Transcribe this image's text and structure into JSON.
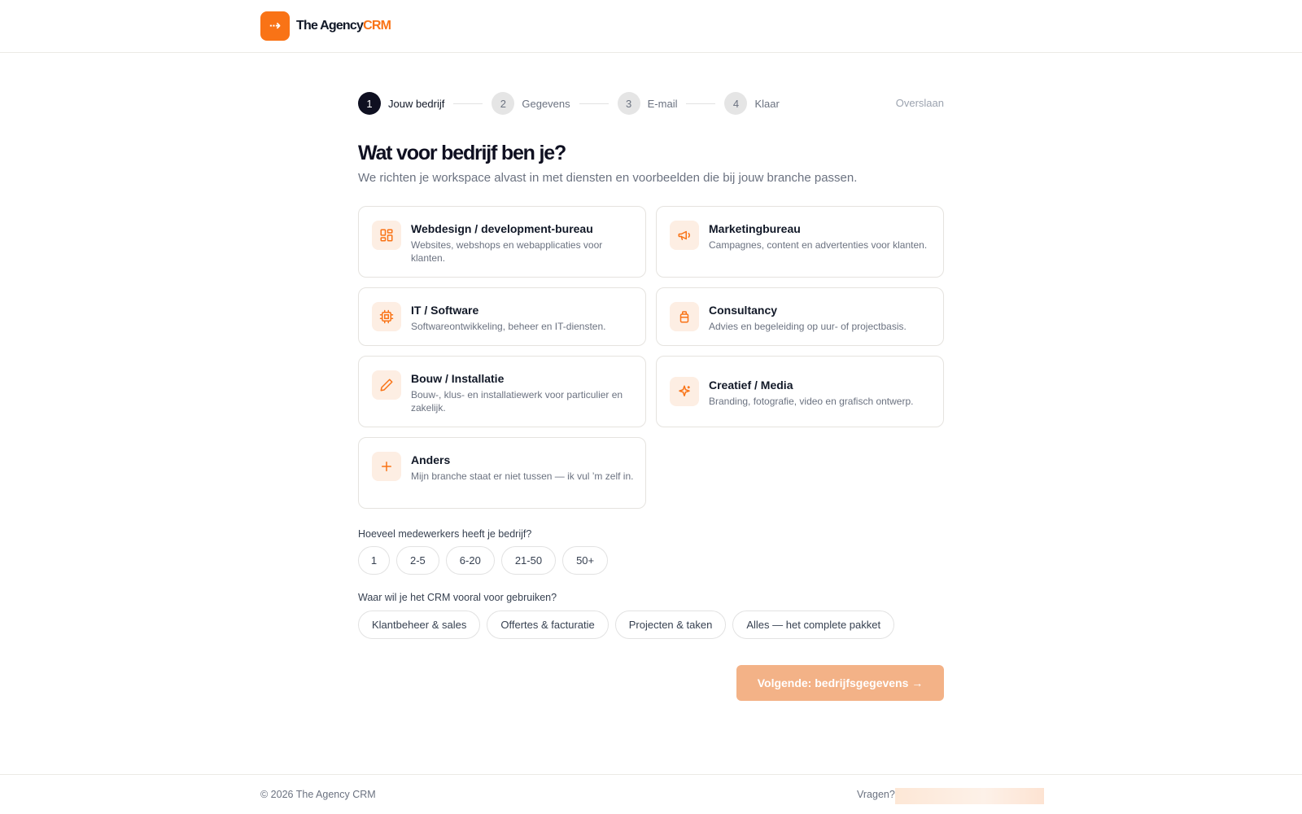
{
  "brand": {
    "name_main": "The Agency",
    "name_accent": "CRM",
    "logo_icon": "arrow-right-left-icon"
  },
  "steps": [
    {
      "number": "1",
      "label": "Jouw bedrijf",
      "active": true
    },
    {
      "number": "2",
      "label": "Gegevens",
      "active": false
    },
    {
      "number": "3",
      "label": "E-mail",
      "active": false
    },
    {
      "number": "4",
      "label": "Klaar",
      "active": false
    }
  ],
  "skip_label": "Overslaan",
  "heading": "Wat voor bedrijf ben je?",
  "subheading": "We richten je workspace alvast in met diensten en voorbeelden die bij jouw branche passen.",
  "business_types": [
    {
      "title": "Webdesign / development-bureau",
      "description": "Websites, webshops en webapplicaties voor klanten.",
      "icon": "layout-grid-icon"
    },
    {
      "title": "Marketingbureau",
      "description": "Campagnes, content en advertenties voor klanten.",
      "icon": "megaphone-icon"
    },
    {
      "title": "IT / Software",
      "description": "Softwareontwikkeling, beheer en IT-diensten.",
      "icon": "cpu-icon"
    },
    {
      "title": "Consultancy",
      "description": "Advies en begeleiding op uur- of projectbasis.",
      "icon": "briefcase-icon"
    },
    {
      "title": "Bouw / Installatie",
      "description": "Bouw-, klus- en installatiewerk voor particulier en zakelijk.",
      "icon": "pencil-icon"
    },
    {
      "title": "Creatief / Media",
      "description": "Branding, fotografie, video en grafisch ontwerp.",
      "icon": "sparkles-icon"
    },
    {
      "title": "Anders",
      "description": "Mijn branche staat er niet tussen — ik vul ’m zelf in.",
      "icon": "plus-icon"
    }
  ],
  "employees": {
    "question": "Hoeveel medewerkers heeft je bedrijf?",
    "options": [
      "1",
      "2-5",
      "6-20",
      "21-50",
      "50+"
    ]
  },
  "usage": {
    "question": "Waar wil je het CRM vooral voor gebruiken?",
    "options": [
      "Klantbeheer & sales",
      "Offertes & facturatie",
      "Projecten & taken",
      "Alles — het complete pakket"
    ]
  },
  "next_button": "Volgende: bedrijfsgegevens →",
  "footer": {
    "copyright": "© 2026 The Agency CRM",
    "questions": "Vragen?"
  },
  "colors": {
    "accent": "#f97316",
    "accent_soft": "#fdeee3",
    "dark": "#0f1021",
    "button_disabled": "#f3b287"
  }
}
